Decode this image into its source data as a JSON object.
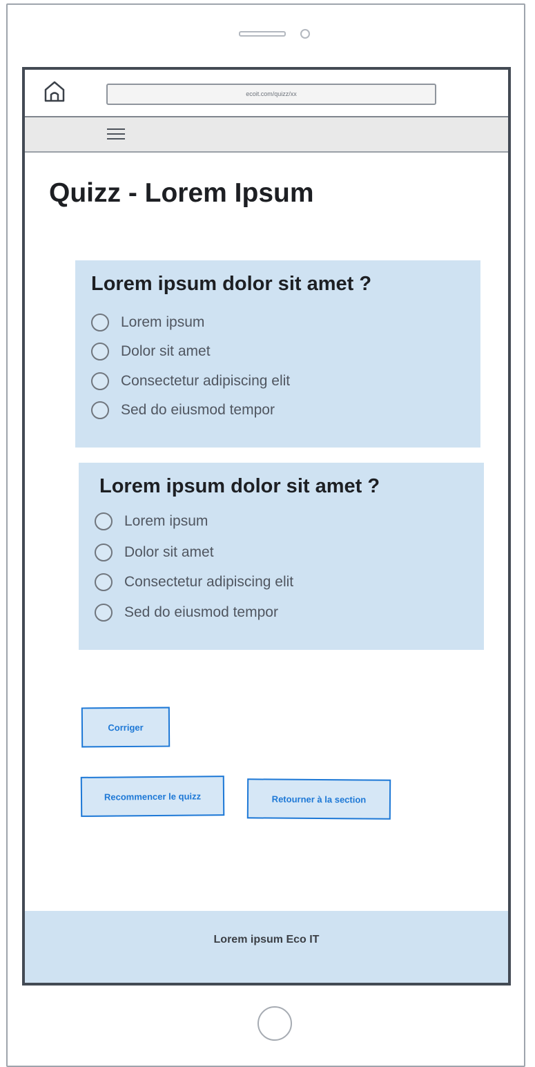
{
  "browser": {
    "url": "ecoit.com/quizz/xx"
  },
  "icons": {
    "home": "home-icon",
    "menu": "hamburger-menu-icon",
    "radio": "radio-button-unchecked-icon"
  },
  "colors": {
    "accent": "#1d78d6",
    "card_background": "#cfe2f2",
    "frame": "#434a54"
  },
  "page": {
    "title": "Quizz - Lorem Ipsum"
  },
  "questions": [
    {
      "text": "Lorem ipsum dolor sit amet ?",
      "options": [
        "Lorem ipsum",
        "Dolor sit amet",
        "Consectetur adipiscing elit",
        "Sed do eiusmod tempor"
      ]
    },
    {
      "text": "Lorem ipsum dolor sit amet ?",
      "options": [
        "Lorem ipsum",
        "Dolor sit amet",
        "Consectetur adipiscing elit",
        "Sed do eiusmod tempor"
      ]
    }
  ],
  "buttons": {
    "correct": "Corriger",
    "restart": "Recommencer le quizz",
    "back": "Retourner à la section"
  },
  "footer": {
    "text": "Lorem ipsum Eco IT"
  }
}
